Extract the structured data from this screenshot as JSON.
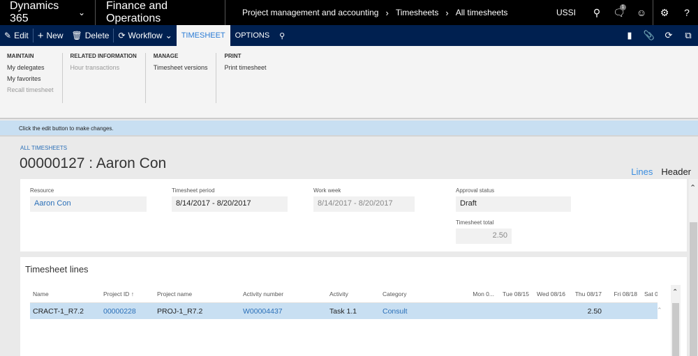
{
  "topbar": {
    "brand": "Dynamics 365",
    "app": "Finance and Operations",
    "breadcrumbs": [
      "Project management and accounting",
      "Timesheets",
      "All timesheets"
    ],
    "company": "USSI",
    "notification_count": "1",
    "icons": [
      "search-icon",
      "notification-icon",
      "feedback-smiley-icon",
      "settings-gear-icon",
      "help-icon"
    ]
  },
  "actionbar": {
    "edit": "Edit",
    "new": "New",
    "delete": "Delete",
    "workflow": "Workflow",
    "tabs": [
      "TIMESHEET",
      "OPTIONS"
    ],
    "active_tab": "TIMESHEET",
    "right_icons": [
      "office-icon",
      "attachment-icon",
      "refresh-icon",
      "open-new-window-icon"
    ]
  },
  "ribbon": {
    "groups": [
      {
        "title": "MAINTAIN",
        "items": [
          {
            "label": "My delegates",
            "enabled": true
          },
          {
            "label": "My favorites",
            "enabled": true
          },
          {
            "label": "Recall timesheet",
            "enabled": false
          }
        ]
      },
      {
        "title": "RELATED INFORMATION",
        "items": [
          {
            "label": "Hour transactions",
            "enabled": false
          }
        ]
      },
      {
        "title": "MANAGE",
        "items": [
          {
            "label": "Timesheet versions",
            "enabled": true
          }
        ]
      },
      {
        "title": "PRINT",
        "items": [
          {
            "label": "Print timesheet",
            "enabled": true
          }
        ]
      }
    ]
  },
  "message": "Click the edit button to make changes.",
  "page": {
    "breadcrumb": "ALL TIMESHEETS",
    "title": "00000127 : Aaron Con",
    "view_tabs": [
      "Lines",
      "Header"
    ],
    "active_view": "Lines"
  },
  "header_fields": {
    "resource": {
      "label": "Resource",
      "value": "Aaron Con"
    },
    "period": {
      "label": "Timesheet period",
      "value": "8/14/2017 - 8/20/2017"
    },
    "work_week": {
      "label": "Work week",
      "value": "8/14/2017 - 8/20/2017"
    },
    "approval": {
      "label": "Approval status",
      "value": "Draft"
    },
    "total": {
      "label": "Timesheet total",
      "value": "2.50"
    }
  },
  "lines": {
    "title": "Timesheet lines",
    "columns": [
      "Name",
      "Project ID",
      "Project name",
      "Activity number",
      "Activity",
      "Category",
      "Mon 0...",
      "Tue 08/15",
      "Wed 08/16",
      "Thu 08/17",
      "Fri 08/18",
      "Sat 0"
    ],
    "sort_indicator": "↑",
    "rows": [
      {
        "name": "CRACT-1_R7.2",
        "project_id": "00000228",
        "project_name": "PROJ-1_R7.2",
        "activity_number": "W00004437",
        "activity": "Task 1.1",
        "category": "Consult",
        "mon": "",
        "tue": "",
        "wed": "",
        "thu": "2.50",
        "fri": "",
        "sat": ""
      }
    ]
  }
}
